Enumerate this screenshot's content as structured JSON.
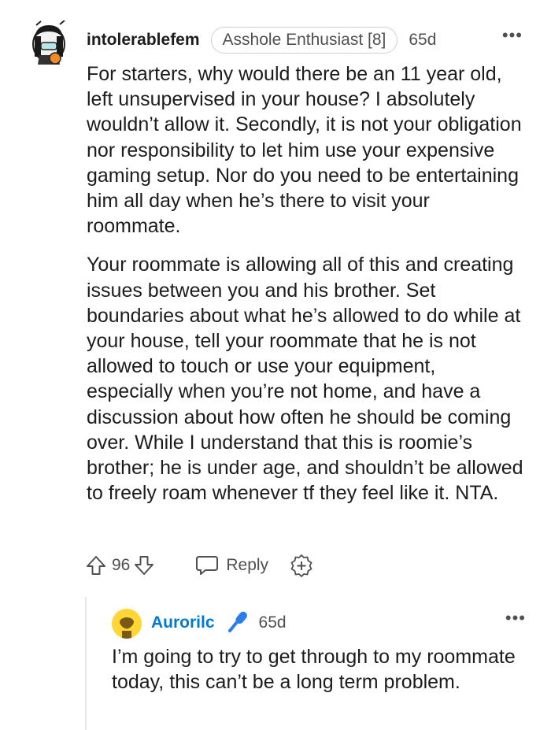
{
  "comment": {
    "username": "intolerablefem",
    "flair": "Asshole Enthusiast [8]",
    "age": "65d",
    "more_label": "•••",
    "paragraphs": [
      "For starters, why would there be an 11 year old, left unsupervised in your house? I absolutely wouldn’t allow it. Secondly, it is not your obligation nor responsibility to let him use your expensive gaming setup. Nor do you need to be entertaining him all day when he’s there to visit your roommate.",
      "Your roommate is allowing all of this and creating issues between you and his brother. Set boundaries about what he’s allowed to do while at your house, tell your roommate that he is not allowed to touch or use your equipment, especially when you’re not home, and have a discussion about how often he should be coming over. While I understand that this is roomie’s brother; he is under age, and shouldn’t be allowed to freely roam whenever tf they feel like it. NTA."
    ],
    "vote_count": "96",
    "reply_label": "Reply"
  },
  "reply": {
    "username": "Aurorilc",
    "age": "65d",
    "more_label": "•••",
    "text": "I’m going to try to get through to my roommate today, this can’t be a long term problem."
  },
  "icons": {
    "upvote": "upvote-arrow-icon",
    "downvote": "downvote-arrow-icon",
    "reply": "speech-bubble-icon",
    "award": "award-plus-icon",
    "op_flair": "microphone-icon"
  },
  "colors": {
    "username_link": "#0079d3",
    "secondary_text": "#505050",
    "text": "#1c1c1c"
  }
}
